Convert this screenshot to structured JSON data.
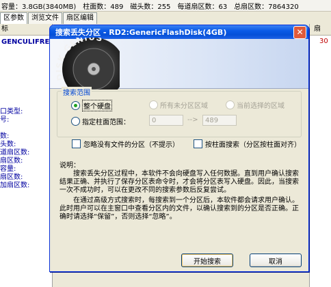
{
  "bg": {
    "info_bar": [
      "容量：3.8GB(3840MB)",
      "柱面数：489",
      "磁头数：255",
      "每道扇区数：63",
      "总扇区数：7864320"
    ],
    "tabs": [
      {
        "label": "区参数"
      },
      {
        "label": "浏览文件"
      },
      {
        "label": "扇区编辑"
      }
    ],
    "left_header": "标",
    "left_row": "GENCULIFRE",
    "left_labels": [
      "口类型:",
      "号:",
      "",
      "数:",
      "头数:",
      "道扇区数:",
      "扇区数:",
      "容量:",
      "扇区数:",
      "加扇区数:"
    ],
    "right_header": "扇",
    "right_value": "30"
  },
  "dialog": {
    "title": "搜索丢失分区 - RD2:GenericFlashDisk(4GB)",
    "close_glyph": "✕",
    "banner_text": "DISK GENIUS",
    "group_title": "搜索范围",
    "radio_whole": "整个硬盘",
    "radio_unpartitioned": "所有未分区区域",
    "radio_selected": "当前选择的区域",
    "radio_range": "指定柱面范围：",
    "range_from": "0",
    "range_arrow": "-->",
    "range_to": "489",
    "check_ignore": "忽略没有文件的分区（不提示）",
    "check_cylinder": "按柱面搜索（分区按柱面对齐）",
    "note_title": "说明：",
    "note_p1": "搜索丢失分区过程中，本软件不会向硬盘写入任何数据。直到用户确认搜索结果正确、并执行了保存分区表命令时，才会将分区表写入硬盘。因此，当搜索一次不成功时，可以在更改不同的搜索参数后反复尝试。",
    "note_p2": "在通过高级方式搜索时，每搜索到一个分区后，本软件都会请求用户确认。此时用户可以在主窗口中查看分区内的文件，以确认搜索到的分区是否正确。正确时请选择“保留”，否则选择“忽略”。",
    "start_button": "开始搜索",
    "cancel_button": "取消"
  }
}
